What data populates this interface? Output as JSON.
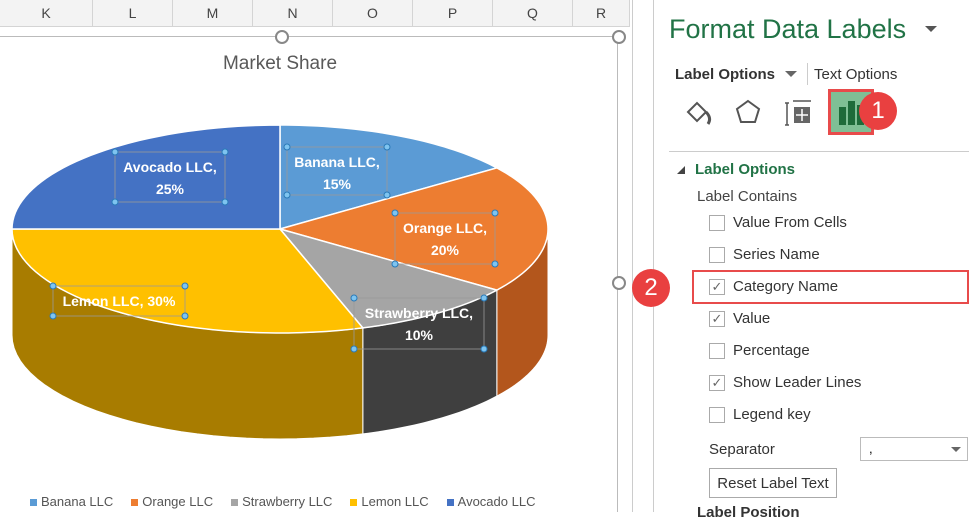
{
  "columns": [
    "K",
    "L",
    "M",
    "N",
    "O",
    "P",
    "Q",
    "R"
  ],
  "chart_data": {
    "type": "pie",
    "title": "Market Share",
    "categories": [
      "Banana LLC",
      "Orange LLC",
      "Strawberry LLC",
      "Lemon LLC",
      "Avocado LLC"
    ],
    "values": [
      15,
      20,
      10,
      30,
      25
    ],
    "colors": [
      "#5b9bd5",
      "#ed7d31",
      "#a5a5a5",
      "#ffc000",
      "#4472c4"
    ],
    "side_colors": [
      "#3d75b0",
      "#b3561c",
      "#3f3f3f",
      "#a87c00",
      "#2e4f8c"
    ],
    "labels": [
      "Banana LLC,",
      "15%",
      "Orange LLC,",
      "20%",
      "Strawberry LLC,",
      "10%",
      "Lemon LLC, 30%",
      "Avocado LLC,",
      "25%"
    ],
    "legend_position": "bottom"
  },
  "pane": {
    "title": "Format Data Labels",
    "tab_label_options": "Label Options",
    "tab_text_options": "Text Options",
    "icons": [
      "fill-line-icon",
      "effects-icon",
      "size-properties-icon",
      "label-options-icon"
    ],
    "badge1": "1",
    "badge2": "2",
    "section": "Label Options",
    "label_contains": "Label Contains",
    "options": [
      {
        "label": "Value From Cells",
        "checked": false
      },
      {
        "label": "Series Name",
        "checked": false
      },
      {
        "label": "Category Name",
        "checked": true
      },
      {
        "label": "Value",
        "checked": true
      },
      {
        "label": "Percentage",
        "checked": false
      },
      {
        "label": "Show Leader Lines",
        "checked": true
      },
      {
        "label": "Legend key",
        "checked": false
      }
    ],
    "separator_label": "Separator",
    "separator_value": ",",
    "reset_button": "Reset Label Text",
    "label_position": "Label Position"
  }
}
